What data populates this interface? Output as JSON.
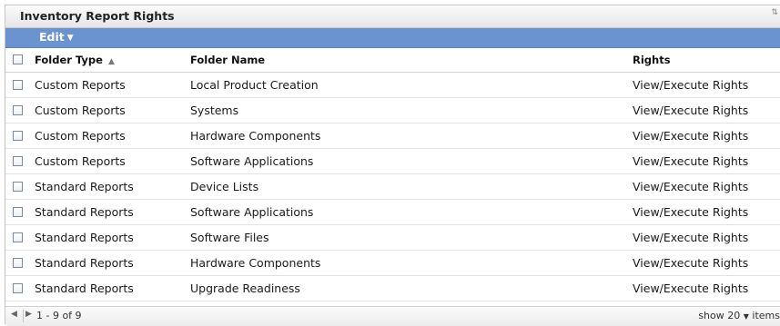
{
  "panel": {
    "title": "Inventory Report Rights"
  },
  "toolbar": {
    "edit_label": "Edit"
  },
  "table": {
    "columns": [
      {
        "label": "Folder Type",
        "sorted": "ascending"
      },
      {
        "label": "Folder Name"
      },
      {
        "label": "Rights"
      }
    ],
    "rows": [
      {
        "type": "Custom Reports",
        "name": "Local Product Creation",
        "rights": "View/Execute Rights"
      },
      {
        "type": "Custom Reports",
        "name": "Systems",
        "rights": "View/Execute Rights"
      },
      {
        "type": "Custom Reports",
        "name": "Hardware Components",
        "rights": "View/Execute Rights"
      },
      {
        "type": "Custom Reports",
        "name": "Software Applications",
        "rights": "View/Execute Rights"
      },
      {
        "type": "Standard Reports",
        "name": "Device Lists",
        "rights": "View/Execute Rights"
      },
      {
        "type": "Standard Reports",
        "name": "Software Applications",
        "rights": "View/Execute Rights"
      },
      {
        "type": "Standard Reports",
        "name": "Software Files",
        "rights": "View/Execute Rights"
      },
      {
        "type": "Standard Reports",
        "name": "Hardware Components",
        "rights": "View/Execute Rights"
      },
      {
        "type": "Standard Reports",
        "name": "Upgrade Readiness",
        "rights": "View/Execute Rights"
      }
    ]
  },
  "footer": {
    "range": "1 - 9 of 9",
    "show_label": "show",
    "page_size": "20",
    "items_label": "items"
  },
  "colors": {
    "toolbar": "#6a93cf",
    "header_bg": "#e6e6e6"
  }
}
